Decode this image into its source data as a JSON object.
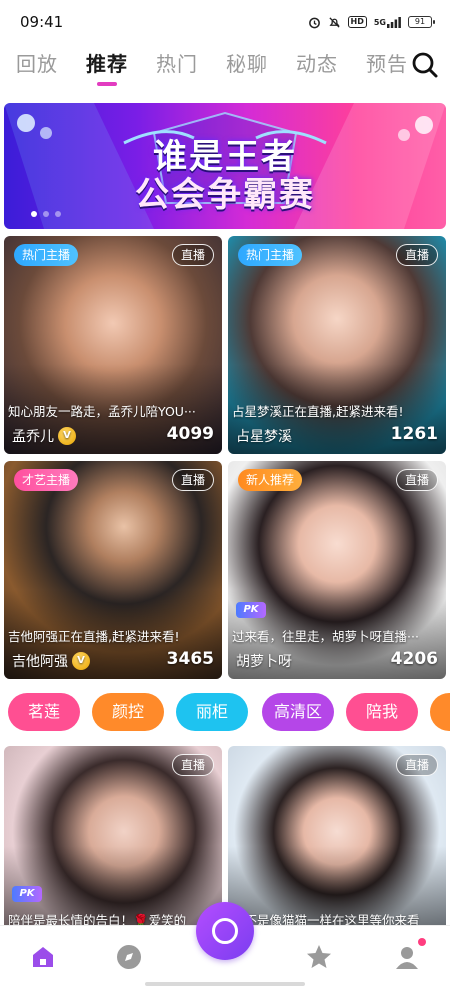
{
  "status": {
    "time": "09:41",
    "battery": "91",
    "network": "5G"
  },
  "tabs": [
    "回放",
    "推荐",
    "热门",
    "秘聊",
    "动态",
    "预告"
  ],
  "active_tab": "推荐",
  "banner": {
    "line1": "谁是王者",
    "line2": "公会争霸赛"
  },
  "cards": [
    {
      "tag": "热门主播",
      "live": "直播",
      "caption": "知心朋友一路走，孟乔儿陪YOU···",
      "name": "孟乔儿",
      "verified": "V",
      "count": "4099"
    },
    {
      "tag": "热门主播",
      "live": "直播",
      "caption": "占星梦溪正在直播,赶紧进来看!",
      "name": "占星梦溪",
      "count": "1261"
    },
    {
      "tag": "才艺主播",
      "live": "直播",
      "caption": "吉他阿强正在直播,赶紧进来看!",
      "name": "吉他阿强",
      "verified": "V",
      "count": "3465"
    },
    {
      "tag": "新人推荐",
      "live": "直播",
      "pk": "PK",
      "caption": "过来看，往里走，胡萝卜呀直播···",
      "name": "胡萝卜呀",
      "count": "4206"
    },
    {
      "live": "直播",
      "pk": "PK",
      "caption": "陪伴是最长情的告白！🌹爱笑的"
    },
    {
      "live": "直播",
      "caption": "恋不是像猫猫一样在这里等你来看"
    }
  ],
  "pills": [
    {
      "label": "茗莲",
      "color": "#ff4f92"
    },
    {
      "label": "颜控",
      "color": "#ff8a2a"
    },
    {
      "label": "丽柜",
      "color": "#1ec3f0"
    },
    {
      "label": "高清区",
      "color": "#b546e8"
    },
    {
      "label": "陪我",
      "color": "#ff4f92"
    }
  ],
  "nav": [
    "home-icon",
    "compass-icon",
    "live-center-icon",
    "star-icon",
    "profile-icon"
  ]
}
